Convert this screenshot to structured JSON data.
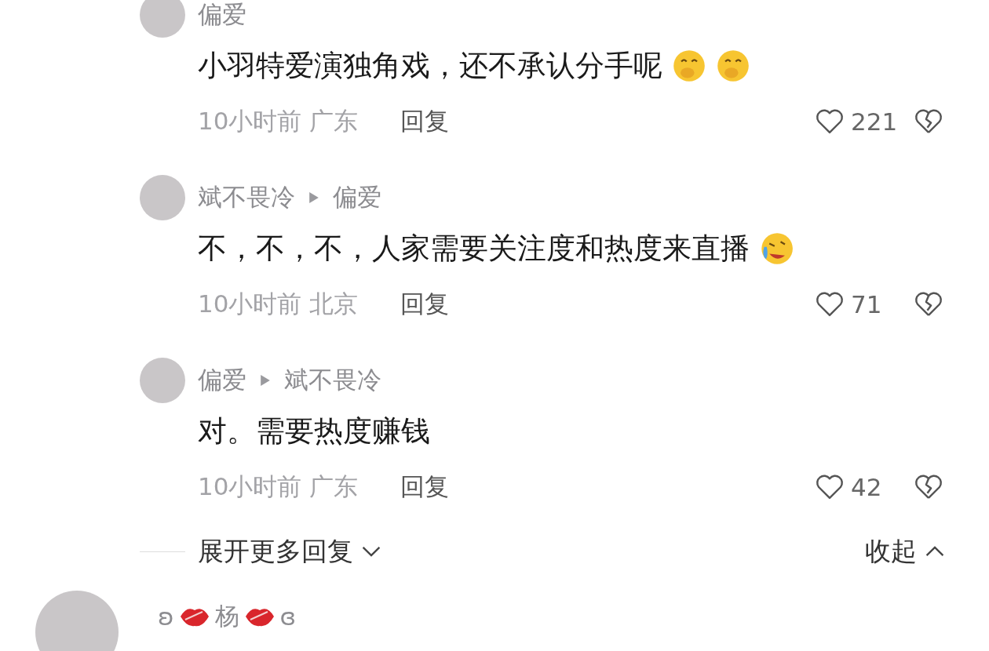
{
  "replies": [
    {
      "name": "偏爱",
      "text": "小羽特爱演独角戏，还不承认分手呢",
      "emojis": [
        {
          "kind": "giggle"
        },
        {
          "kind": "giggle"
        }
      ],
      "time": "10小时前",
      "location": "广东",
      "reply_label": "回复",
      "likes": "221"
    },
    {
      "name": "斌不畏冷",
      "reply_to": "偏爱",
      "text": "不，不，不，人家需要关注度和热度来直播",
      "emojis": [
        {
          "kind": "laugh-cry"
        }
      ],
      "time": "10小时前",
      "location": "北京",
      "reply_label": "回复",
      "likes": "71"
    },
    {
      "name": "偏爱",
      "reply_to": "斌不畏冷",
      "text": "对。需要热度赚钱",
      "time": "10小时前",
      "location": "广东",
      "reply_label": "回复",
      "likes": "42"
    }
  ],
  "expand": {
    "label": "展开更多回复",
    "collapse": "收起"
  },
  "next_comment": {
    "name_parts": [
      {
        "kind": "text",
        "text": "ʚ"
      },
      {
        "kind": "lips"
      },
      {
        "kind": "text",
        "text": "杨"
      },
      {
        "kind": "lips"
      },
      {
        "kind": "text",
        "text": "ɞ"
      }
    ]
  }
}
